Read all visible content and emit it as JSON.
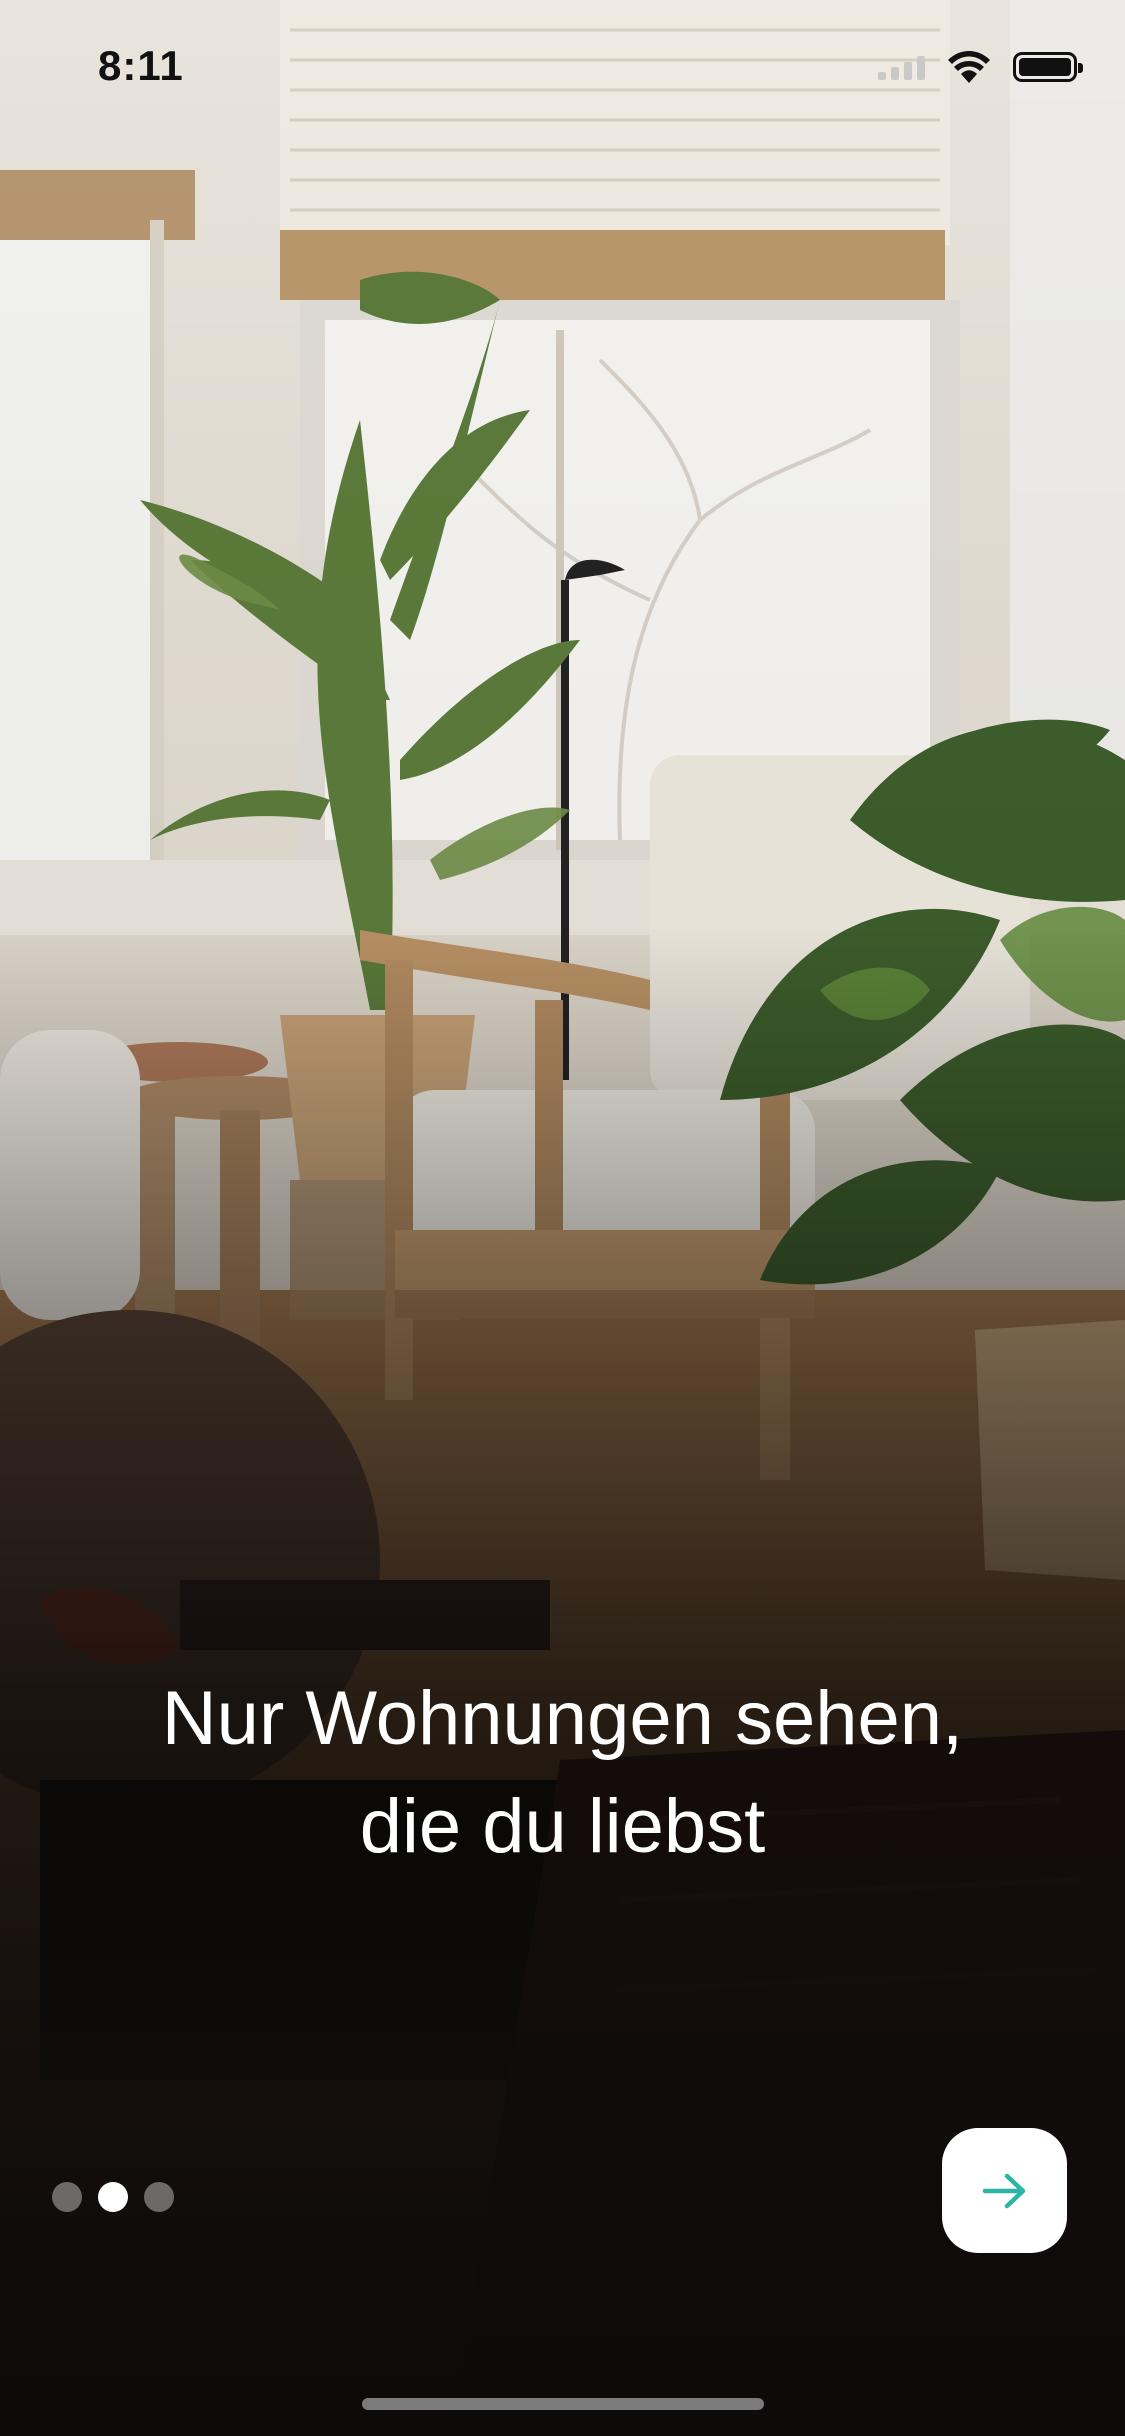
{
  "status_bar": {
    "time": "8:11",
    "icons": [
      "signal-icon",
      "wifi-icon",
      "battery-icon"
    ]
  },
  "onboarding": {
    "headline_line1": "Nur Wohnungen sehen,",
    "headline_line2": "die du liebst",
    "page_count": 3,
    "active_page_index": 1,
    "next_icon": "arrow-right-icon"
  },
  "colors": {
    "accent": "#2bb5a6",
    "text": "#ffffff",
    "button_bg": "#ffffff"
  }
}
